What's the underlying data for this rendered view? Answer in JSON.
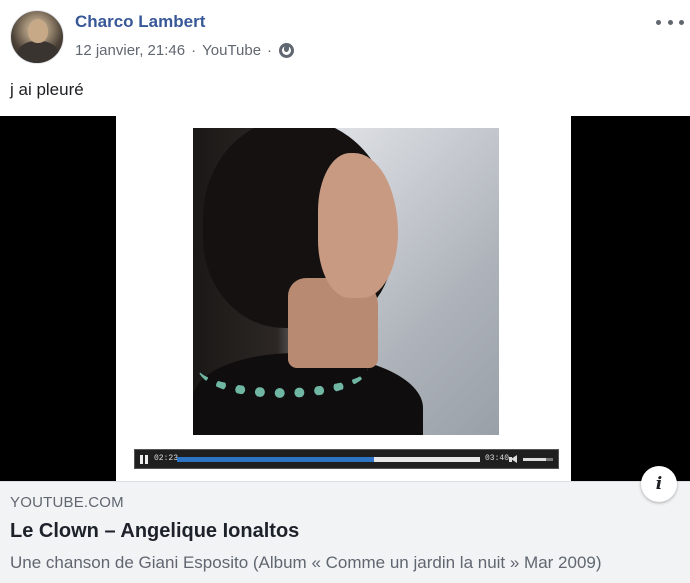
{
  "post": {
    "author": "Charco Lambert",
    "timestamp": "12 janvier, 21:46",
    "separator": "·",
    "source": "YouTube",
    "audience_icon": "globe-icon",
    "text": "j ai pleuré"
  },
  "video": {
    "current_time": "02:23",
    "duration": "03:40",
    "progress_fraction": 0.65,
    "volume_fraction": 0.75
  },
  "link_card": {
    "domain": "YOUTUBE.COM",
    "title": "Le Clown – Angelique Ionaltos",
    "description": "Une chanson de Giani Esposito (Album « Comme un jardin la nuit » Mar 2009)",
    "info_label": "i"
  },
  "colors": {
    "author_link": "#385898",
    "meta_text": "#606770",
    "card_background": "#f2f3f5",
    "progress_fill": "#2d74c4"
  }
}
